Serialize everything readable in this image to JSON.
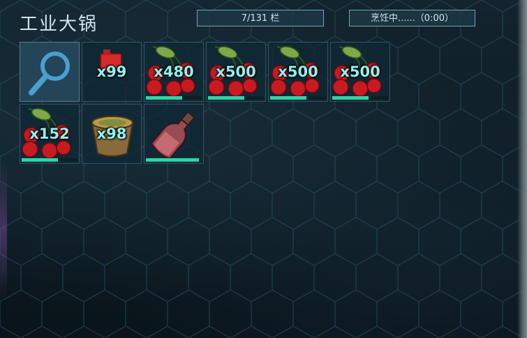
{
  "inventory": {
    "title": "工业大锅",
    "capacity_text": "7/131 栏",
    "cooking_status": "烹饪中......（0:00）"
  },
  "slots": [
    {
      "item": "search-icon",
      "quantity": "",
      "spoil_fraction": null
    },
    {
      "item": "gasoline-can-icon",
      "quantity": "x99",
      "spoil_fraction": null
    },
    {
      "item": "berry-icon",
      "quantity": "x480",
      "spoil_fraction": 0.65
    },
    {
      "item": "berry-icon",
      "quantity": "x500",
      "spoil_fraction": 0.65
    },
    {
      "item": "berry-icon",
      "quantity": "x500",
      "spoil_fraction": 0.65
    },
    {
      "item": "berry-icon",
      "quantity": "x500",
      "spoil_fraction": 0.65
    },
    {
      "item": "berry-icon",
      "quantity": "x152",
      "spoil_fraction": 0.65
    },
    {
      "item": "sap-bowl-icon",
      "quantity": "x98",
      "spoil_fraction": null
    },
    {
      "item": "potion-bottle-icon",
      "quantity": "",
      "spoil_fraction": 0.95
    }
  ],
  "colors": {
    "accent": "#8ef2f2",
    "spoil_bar": "#2fd4a6",
    "box_border": "#6fa4b6"
  }
}
